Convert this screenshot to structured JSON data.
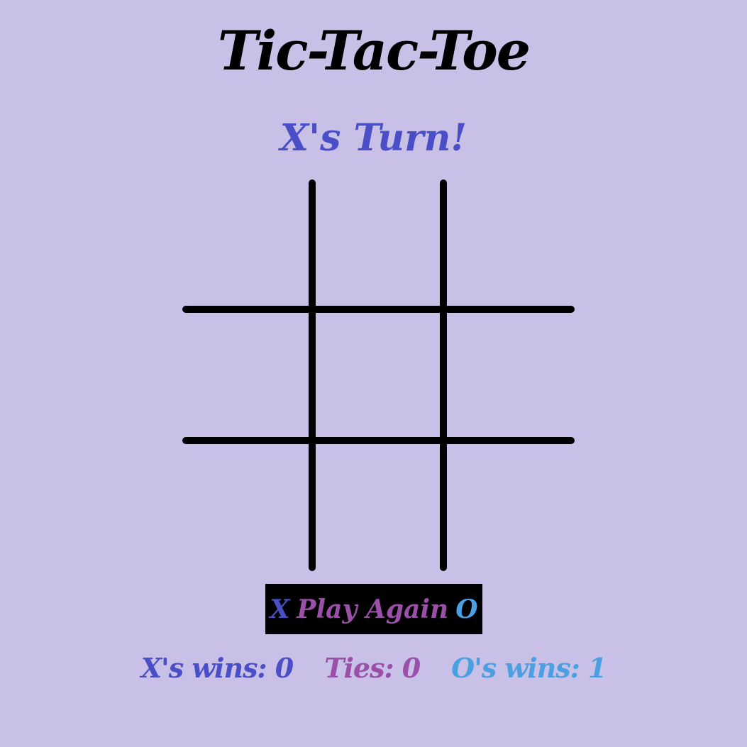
{
  "title": "Tic-Tac-Toe",
  "status": {
    "turn_text": "X's Turn!"
  },
  "board": {
    "cells": [
      "",
      "",
      "",
      "",
      "",
      "",
      "",
      "",
      ""
    ]
  },
  "play_again": {
    "x_mark": "X",
    "label": "Play Again",
    "o_mark": "O"
  },
  "scores": {
    "x_wins": "X's wins: 0",
    "ties": "Ties: 0",
    "o_wins": "O's wins: 1"
  },
  "colors": {
    "background": "#c8c0e7",
    "x_color": "#4a4fc8",
    "tie_color": "#9a4fa8",
    "o_color": "#4aa0e0",
    "grid": "#000000"
  }
}
